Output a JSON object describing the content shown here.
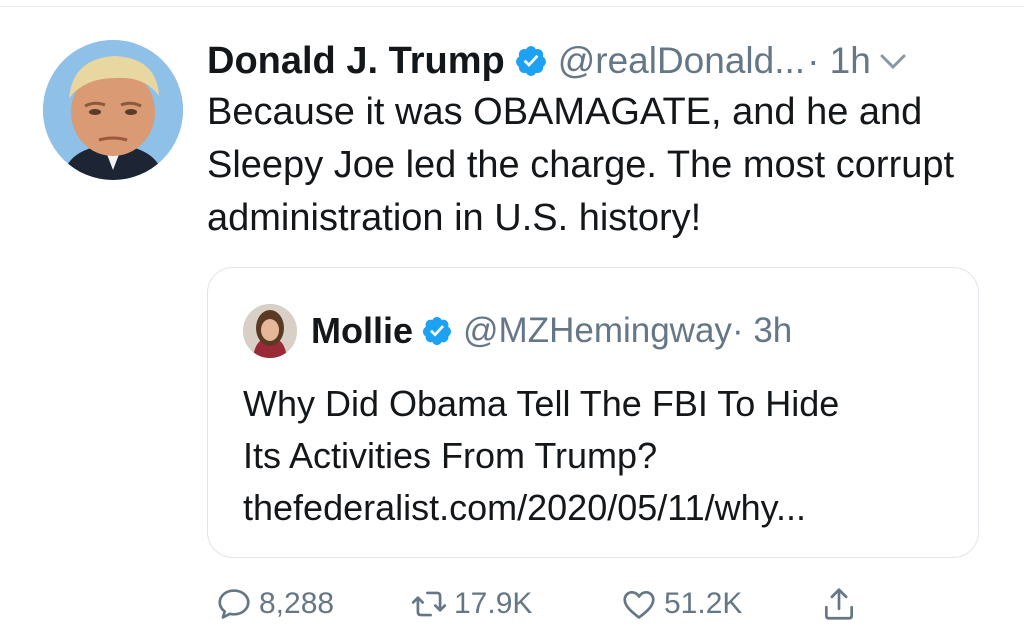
{
  "tweet": {
    "name": "Donald J. Trump",
    "handle": "@realDonald...",
    "time": "· 1h",
    "text": "Because it was OBAMAGATE, and he and Sleepy Joe led the charge. The most corrupt administration in U.S. history!"
  },
  "quote": {
    "name": "Mollie",
    "handle": "@MZHemingway",
    "time": "· 3h",
    "text_line1": "Why Did Obama Tell The FBI To Hide",
    "text_line2": "Its Activities From Trump?",
    "link": "thefederalist.com/2020/05/11/why..."
  },
  "actions": {
    "reply_count": "8,288",
    "retweet_count": "17.9K",
    "like_count": "51.2K"
  },
  "colors": {
    "text": "#14171a",
    "secondary": "#657786",
    "verified_blue": "#1da1f2",
    "border": "#dfe5ea"
  },
  "icons": [
    "verified-badge-icon",
    "chevron-down-icon",
    "reply-icon",
    "retweet-icon",
    "like-icon",
    "share-icon"
  ]
}
